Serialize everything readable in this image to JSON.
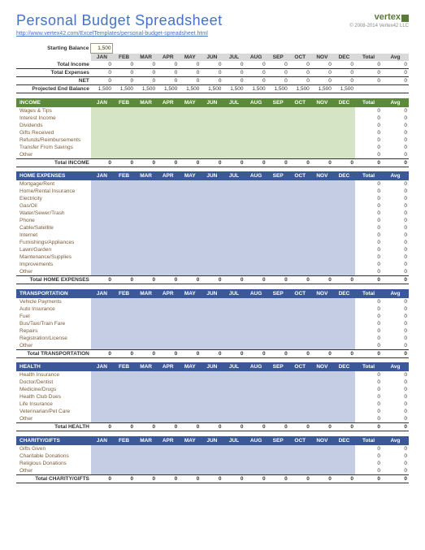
{
  "header": {
    "title": "Personal Budget Spreadsheet",
    "url": "http://www.vertex42.com/ExcelTemplates/personal-budget-spreadsheet.html",
    "logo": "vertex",
    "copyright": "© 2008-2014 Vertex42 LLC"
  },
  "starting": {
    "label": "Starting Balance",
    "value": "1,500"
  },
  "months": [
    "JAN",
    "FEB",
    "MAR",
    "APR",
    "MAY",
    "JUN",
    "JUL",
    "AUG",
    "SEP",
    "OCT",
    "NOV",
    "DEC"
  ],
  "totalCol": "Total",
  "avgCol": "Avg",
  "summary": [
    {
      "label": "Total Income",
      "vals": [
        "0",
        "0",
        "0",
        "0",
        "0",
        "0",
        "0",
        "0",
        "0",
        "0",
        "0",
        "0"
      ],
      "total": "0",
      "avg": "0"
    },
    {
      "label": "Total Expenses",
      "vals": [
        "0",
        "0",
        "0",
        "0",
        "0",
        "0",
        "0",
        "0",
        "0",
        "0",
        "0",
        "0"
      ],
      "total": "0",
      "avg": "0"
    },
    {
      "label": "NET",
      "vals": [
        "0",
        "0",
        "0",
        "0",
        "0",
        "0",
        "0",
        "0",
        "0",
        "0",
        "0",
        "0"
      ],
      "total": "0",
      "avg": "0",
      "net": true
    },
    {
      "label": "Projected End Balance",
      "vals": [
        "1,500",
        "1,500",
        "1,500",
        "1,500",
        "1,500",
        "1,500",
        "1,500",
        "1,500",
        "1,500",
        "1,500",
        "1,500",
        "1,500"
      ],
      "total": "",
      "avg": ""
    }
  ],
  "sections": [
    {
      "name": "INCOME",
      "cls": "inc",
      "cell": "inc-cell",
      "rows": [
        "Wages & Tips",
        "Interest Income",
        "Dividends",
        "Gifts Received",
        "Refunds/Reimbursements",
        "Transfer From Savings",
        "Other"
      ],
      "totalLabel": "Total INCOME"
    },
    {
      "name": "HOME EXPENSES",
      "cls": "exp",
      "cell": "exp-cell",
      "rows": [
        "Mortgage/Rent",
        "Home/Rental Insurance",
        "Electricity",
        "Gas/Oil",
        "Water/Sewer/Trash",
        "Phone",
        "Cable/Satellite",
        "Internet",
        "Furnishings/Appliances",
        "Lawn/Garden",
        "Maintenance/Supplies",
        "Improvements",
        "Other"
      ],
      "totalLabel": "Total HOME EXPENSES"
    },
    {
      "name": "TRANSPORTATION",
      "cls": "exp",
      "cell": "exp-cell",
      "rows": [
        "Vehicle Payments",
        "Auto Insurance",
        "Fuel",
        "Bus/Taxi/Train Fare",
        "Repairs",
        "Registration/License",
        "Other"
      ],
      "totalLabel": "Total TRANSPORTATION"
    },
    {
      "name": "HEALTH",
      "cls": "exp",
      "cell": "exp-cell",
      "rows": [
        "Health Insurance",
        "Doctor/Dentist",
        "Medicine/Drugs",
        "Health Club Dues",
        "Life Insurance",
        "Veterinarian/Pet Care",
        "Other"
      ],
      "totalLabel": "Total HEALTH"
    },
    {
      "name": "CHARITY/GIFTS",
      "cls": "exp",
      "cell": "exp-cell",
      "rows": [
        "Gifts Given",
        "Charitable Donations",
        "Religious Donations",
        "Other"
      ],
      "totalLabel": "Total CHARITY/GIFTS"
    }
  ]
}
